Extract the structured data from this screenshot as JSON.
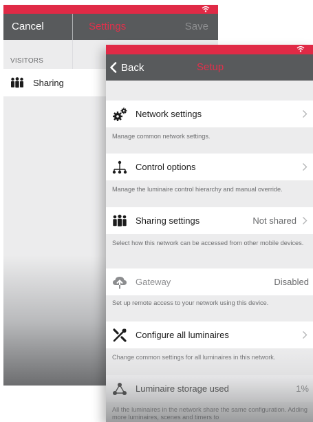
{
  "back_screen": {
    "cancel_label": "Cancel",
    "title": "Settings",
    "save_label": "Save",
    "section_label": "VISITORS",
    "row_label": "Sharing"
  },
  "front_screen": {
    "back_label": "Back",
    "title": "Setup",
    "items": [
      {
        "label": "Network settings",
        "value": "",
        "icon": "gears-icon",
        "description": "Manage common network settings."
      },
      {
        "label": "Control options",
        "value": "",
        "icon": "hierarchy-icon",
        "description": "Manage the luminaire control hierarchy and manual override."
      },
      {
        "label": "Sharing settings",
        "value": "Not shared",
        "icon": "people-icon",
        "description": "Select how this network can be accessed from other mobile devices."
      },
      {
        "label": "Gateway",
        "value": "Disabled",
        "icon": "cloud-upload-icon",
        "description": "Set up remote access to your network using this device."
      },
      {
        "label": "Configure all luminaires",
        "value": "",
        "icon": "tools-icon",
        "description": "Change common settings for all luminaires in this network."
      },
      {
        "label": "Luminaire storage used",
        "value": "1%",
        "icon": "nodes-icon",
        "description": "All the luminaires in the network share the same configuration. Adding more luminaires, scenes and timers to"
      }
    ]
  },
  "colors": {
    "accent": "#e02a46",
    "navbar": "#585a5c",
    "background": "#ececed"
  }
}
